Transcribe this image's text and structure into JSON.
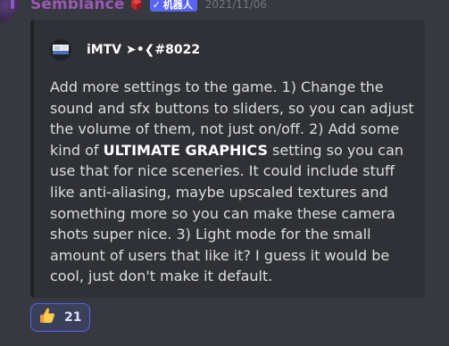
{
  "message": {
    "author": "Semblance",
    "bot_tag": "机器人",
    "bot_check": "✓",
    "timestamp": "2021/11/06",
    "role_color": "#9b59b6"
  },
  "embed": {
    "author": "iMTV ➤•❮#8022",
    "description_parts": {
      "before_bold": "Add more settings to the game. 1) Change the sound and sfx buttons to sliders, so you can adjust the volume of them, not just on/off. 2) Add some kind of ",
      "bold": "ULTIMATE GRAPHICS",
      "after_bold": " setting so you can use that for nice sceneries. It could include stuff like anti-aliasing, maybe upscaled textures and something more so you can make these camera shots super nice. 3) Light mode for the small amount of users that like it? I guess it would be cool, just don't make it default."
    }
  },
  "reactions": [
    {
      "emoji": "👍",
      "icon": "thumbs-up-icon",
      "count": "21"
    }
  ],
  "colors": {
    "background": "#36393f",
    "embed_background": "#2f3136",
    "bot_tag": "#5865f2",
    "reaction_border": "#5865f2"
  }
}
